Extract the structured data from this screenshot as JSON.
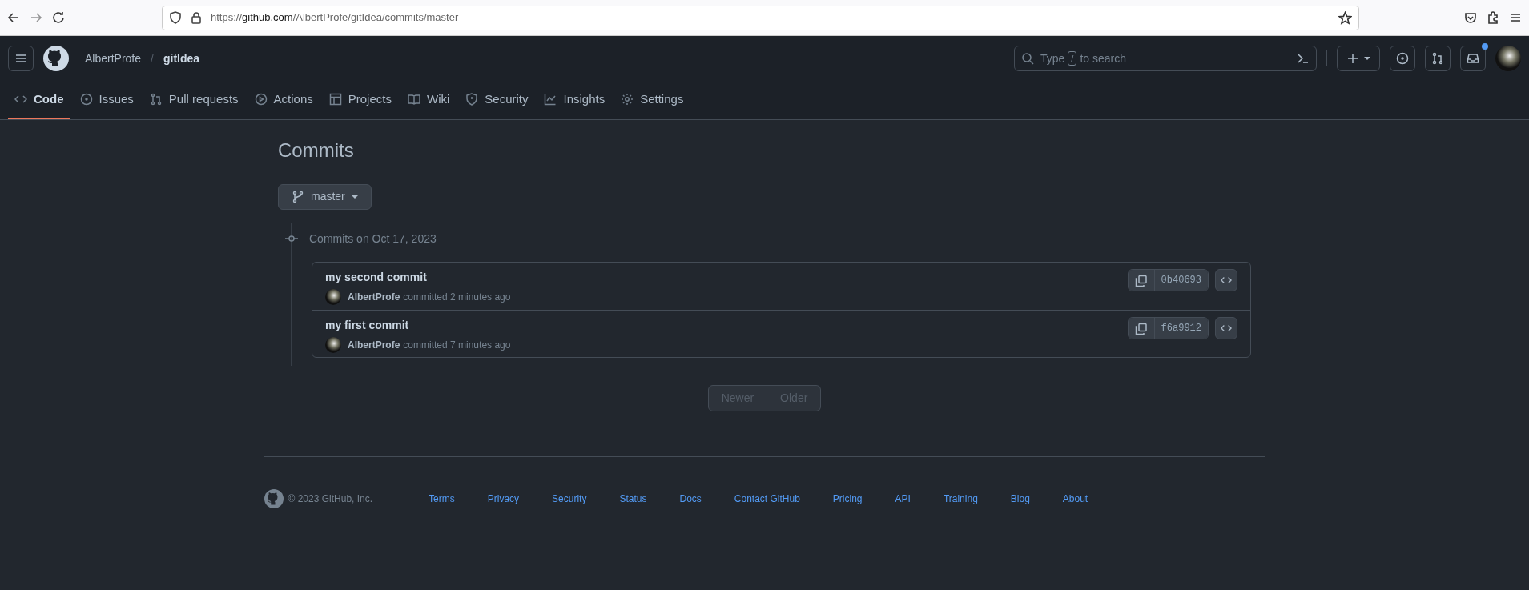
{
  "browser": {
    "url_host": "https://github.com",
    "url_path": "/AlbertProfe/gitIdea/commits/master"
  },
  "header": {
    "owner": "AlbertProfe",
    "separator": "/",
    "repo": "gitIdea",
    "search": {
      "prefix": "Type",
      "key": "/",
      "suffix": "to search"
    },
    "notifications_unread": true
  },
  "tabs": [
    {
      "label": "Code",
      "selected": true
    },
    {
      "label": "Issues",
      "selected": false
    },
    {
      "label": "Pull requests",
      "selected": false
    },
    {
      "label": "Actions",
      "selected": false
    },
    {
      "label": "Projects",
      "selected": false
    },
    {
      "label": "Wiki",
      "selected": false
    },
    {
      "label": "Security",
      "selected": false
    },
    {
      "label": "Insights",
      "selected": false
    },
    {
      "label": "Settings",
      "selected": false
    }
  ],
  "page_title": "Commits",
  "branch": "master",
  "groups": [
    {
      "heading": "Commits on Oct 17, 2023",
      "commits": [
        {
          "message": "my second commit",
          "author": "AlbertProfe",
          "time": "committed 2 minutes ago",
          "sha": "0b40693"
        },
        {
          "message": "my first commit",
          "author": "AlbertProfe",
          "time": "committed 7 minutes ago",
          "sha": "f6a9912"
        }
      ]
    }
  ],
  "pagination": [
    {
      "label": "Newer",
      "disabled": true
    },
    {
      "label": "Older",
      "disabled": true
    }
  ],
  "footer": {
    "copyright": "© 2023 GitHub, Inc.",
    "links": [
      "Terms",
      "Privacy",
      "Security",
      "Status",
      "Docs",
      "Contact GitHub",
      "Pricing",
      "API",
      "Training",
      "Blog",
      "About"
    ]
  }
}
